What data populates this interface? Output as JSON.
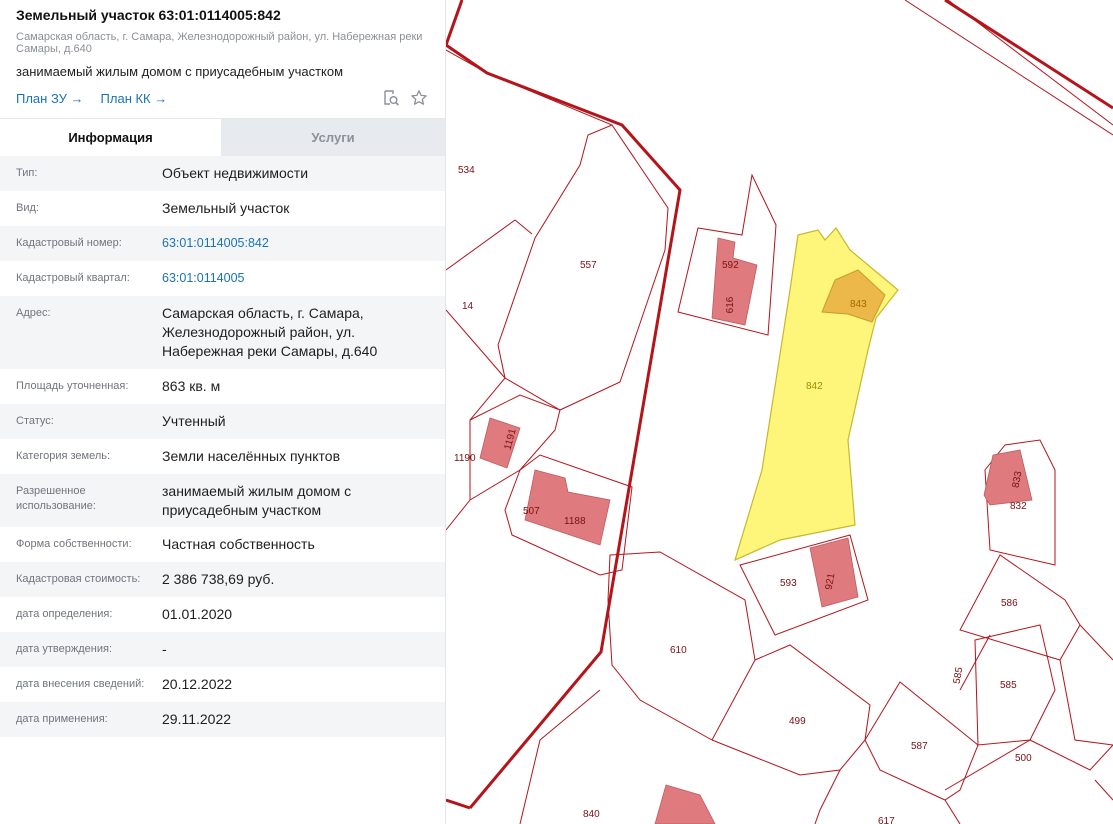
{
  "header": {
    "title": "Земельный участок 63:01:0114005:842",
    "address": "Самарская область, г. Самара, Железнодорожный район, ул. Набережная реки Самары, д.640",
    "use": "занимаемый жилым домом с приусадебным участком",
    "links": [
      "План ЗУ →",
      "План КК →"
    ],
    "tools": [
      "search-document-icon",
      "star-icon"
    ]
  },
  "tabs": [
    "Информация",
    "Услуги"
  ],
  "rows": [
    {
      "k": "Тип:",
      "v": "Объект недвижимости"
    },
    {
      "k": "Вид:",
      "v": "Земельный участок"
    },
    {
      "k": "Кадастровый номер:",
      "v": "63:01:0114005:842"
    },
    {
      "k": "Кадастровый квартал:",
      "v": "63:01:0114005"
    },
    {
      "k": "Адрес:",
      "v": "Самарская область, г. Самара, Железнодорожный район, ул. Набережная реки Самары, д.640"
    },
    {
      "k": "Площадь уточненная:",
      "v": "863 кв. м"
    },
    {
      "k": "Статус:",
      "v": "Учтенный"
    },
    {
      "k": "Категория земель:",
      "v": "Земли населённых пунктов"
    },
    {
      "k": "Разрешенное использование:",
      "v": "занимаемый жилым домом с приусадебным участком"
    },
    {
      "k": "Форма собственности:",
      "v": "Частная собственность"
    },
    {
      "k": "Кадастровая стоимость:",
      "v": "2 386 738,69 руб."
    },
    {
      "k": "дата определения:",
      "v": "01.01.2020"
    },
    {
      "k": "дата утверждения:",
      "v": "-"
    },
    {
      "k": "дата внесения сведений:",
      "v": "20.12.2022"
    },
    {
      "k": "дата применения:",
      "v": "29.11.2022"
    }
  ],
  "map": {
    "colors": {
      "parcel_line": "#b4141a",
      "selected_fill": "#fdf67b",
      "building_fill": "#df7b7e",
      "selected_building": "#ecb84a"
    },
    "labels": [
      "534",
      "557",
      "592",
      "616",
      "14",
      "843",
      "842",
      "1190",
      "1191",
      "507",
      "1188",
      "593",
      "921",
      "833",
      "832",
      "610",
      "586",
      "585",
      "585",
      "499",
      "587",
      "500",
      "840",
      "617"
    ]
  }
}
